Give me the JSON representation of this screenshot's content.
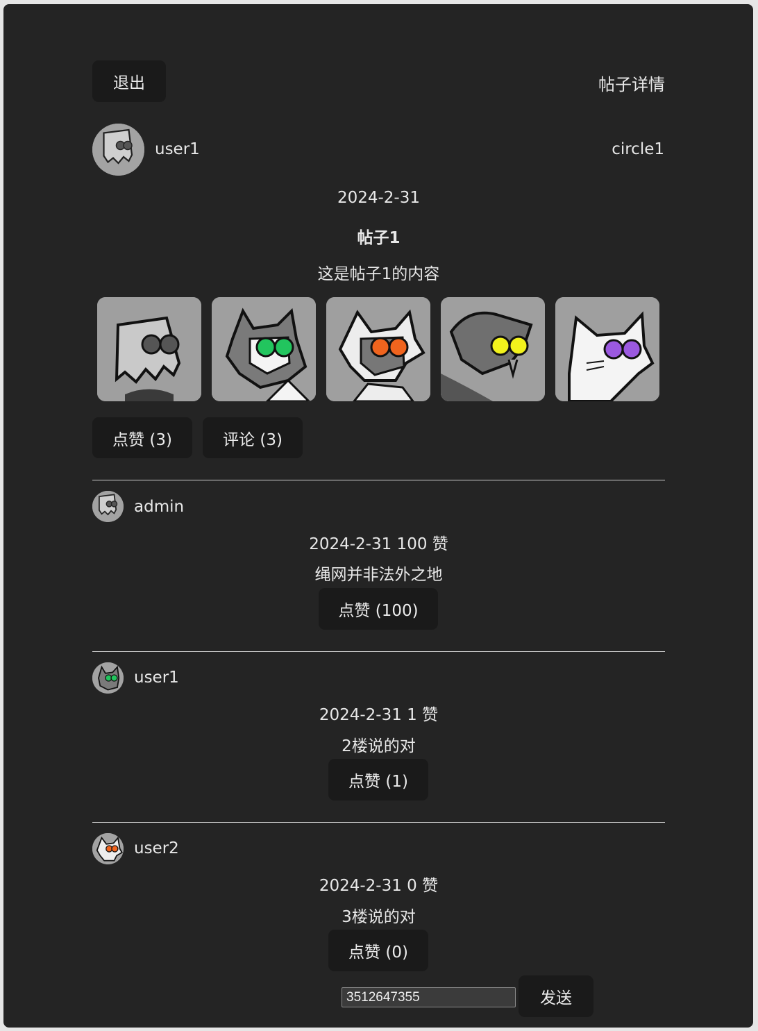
{
  "header": {
    "logout_label": "退出",
    "page_title": "帖子详情"
  },
  "post": {
    "author": "user1",
    "circle": "circle1",
    "date": "2024-2-31",
    "title": "帖子1",
    "content": "这是帖子1的内容",
    "images": [
      {
        "icon": "paperbag-character-gray-eyes"
      },
      {
        "icon": "cat-character-green-eyes"
      },
      {
        "icon": "cat-character-orange-eyes"
      },
      {
        "icon": "dog-character-yellow-eyes"
      },
      {
        "icon": "white-cat-character-purple-eyes"
      }
    ],
    "like_label": "点赞 (3)",
    "comment_label": "评论 (3)"
  },
  "comments": [
    {
      "user": "admin",
      "meta": "2024-2-31  100 赞",
      "text": "绳网并非法外之地",
      "like_label": "点赞 (100)",
      "avatar_icon": "paperbag-avatar-icon"
    },
    {
      "user": "user1",
      "meta": "2024-2-31  1 赞",
      "text": "2楼说的对",
      "like_label": "点赞 (1)",
      "avatar_icon": "cat-green-avatar-icon"
    },
    {
      "user": "user2",
      "meta": "2024-2-31  0 赞",
      "text": "3楼说的对",
      "like_label": "点赞 (0)",
      "avatar_icon": "cat-orange-avatar-icon"
    }
  ],
  "composer": {
    "input_value": "3512647355",
    "send_label": "发送"
  },
  "colors": {
    "background": "#242424",
    "button": "#1a1a1a",
    "text": "#e8e8e8",
    "eye_gray": "#555555",
    "eye_green": "#22c55e",
    "eye_orange": "#f0641e",
    "eye_yellow": "#f2f21c",
    "eye_purple": "#9b59e0"
  }
}
